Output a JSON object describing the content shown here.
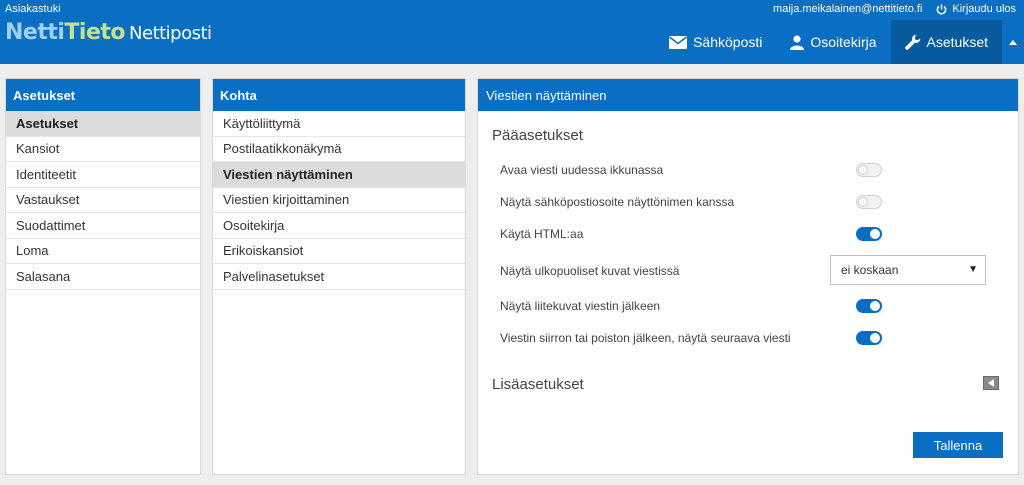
{
  "header": {
    "support_link": "Asiakastuki",
    "logo": {
      "part1": "Netti",
      "part2": "Tieto",
      "product": "Nettiposti"
    },
    "user_email": "maija.meikalainen@nettitieto.fi",
    "logout_label": "Kirjaudu ulos",
    "nav": [
      {
        "label": "Sähköposti",
        "icon": "envelope-icon"
      },
      {
        "label": "Osoitekirja",
        "icon": "person-icon"
      },
      {
        "label": "Asetukset",
        "icon": "wrench-icon"
      }
    ]
  },
  "settings_panel": {
    "title": "Asetukset",
    "items": [
      "Asetukset",
      "Kansiot",
      "Identiteetit",
      "Vastaukset",
      "Suodattimet",
      "Loma",
      "Salasana"
    ],
    "selected_index": 0
  },
  "section_panel": {
    "title": "Kohta",
    "items": [
      "Käyttöliittymä",
      "Postilaatikkonäkymä",
      "Viestien näyttäminen",
      "Viestien kirjoittaminen",
      "Osoitekirja",
      "Erikoiskansiot",
      "Palvelinasetukset"
    ],
    "selected_index": 2
  },
  "detail_panel": {
    "title": "Viestien näyttäminen",
    "main_section": "Pääasetukset",
    "settings": [
      {
        "label": "Avaa viesti uudessa ikkunassa",
        "enabled": false
      },
      {
        "label": "Näytä sähköpostiosoite näyttönimen kanssa",
        "enabled": false
      },
      {
        "label": "Käytä HTML:aa",
        "enabled": true
      },
      {
        "label": "Näytä ulkopuoliset kuvat viestissä",
        "select_value": "ei koskaan"
      },
      {
        "label": "Näytä liitekuvat viestin jälkeen",
        "enabled": true
      },
      {
        "label": "Viestin siirron tai poiston jälkeen, näytä seuraava viesti",
        "enabled": true
      }
    ],
    "extra_section": "Lisäasetukset",
    "save_label": "Tallenna"
  }
}
